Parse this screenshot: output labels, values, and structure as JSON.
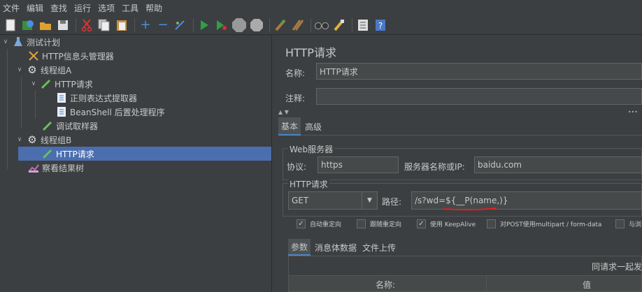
{
  "menu": [
    "文件",
    "编辑",
    "查找",
    "运行",
    "选项",
    "工具",
    "帮助"
  ],
  "toolbar_icons": [
    "new-icon",
    "templates-icon",
    "open-icon",
    "save-icon",
    "cut-icon",
    "copy-icon",
    "paste-icon",
    "expand-icon",
    "collapse-icon",
    "toggle-icon",
    "start-icon",
    "start-no-pause-icon",
    "stop-icon",
    "shutdown-icon",
    "clear-icon",
    "clear-all-icon",
    "search-icon",
    "reset-search-icon",
    "function-helper-icon",
    "help-icon"
  ],
  "tree": {
    "test_plan": "测试计划",
    "header_manager": "HTTP信息头管理器",
    "thread_group_a": "线程组A",
    "http_request_a": "HTTP请求",
    "regex_extractor": "正则表达式提取器",
    "beanshell": "BeanShell 后置处理程序",
    "debug_sampler": "调试取样器",
    "thread_group_b": "线程组B",
    "http_request_b": "HTTP请求",
    "result_tree": "察看结果树"
  },
  "panel": {
    "title": "HTTP请求",
    "name_label": "名称:",
    "name_value": "HTTP请求",
    "comment_label": "注释:",
    "comment_value": "",
    "tabs": [
      "基本",
      "高级"
    ],
    "web_server": {
      "title": "Web服务器",
      "protocol_label": "协议:",
      "protocol_value": "https",
      "server_label": "服务器名称或IP:",
      "server_value": "baidu.com"
    },
    "http_request": {
      "title": "HTTP请求",
      "method": "GET",
      "path_label": "路径:",
      "path_value": "/s?wd=${__P(name,)}"
    },
    "checkboxes": [
      {
        "label": "自动重定向",
        "checked": true
      },
      {
        "label": "跟随重定向",
        "checked": false
      },
      {
        "label": "使用 KeepAlive",
        "checked": true
      },
      {
        "label": "对POST使用multipart / form-data",
        "checked": false
      },
      {
        "label": "与浏",
        "checked": false
      }
    ],
    "subtabs": [
      "参数",
      "消息体数据",
      "文件上传"
    ],
    "send_with": "同请求一起发",
    "table_headers": [
      "名称:",
      "值"
    ]
  }
}
